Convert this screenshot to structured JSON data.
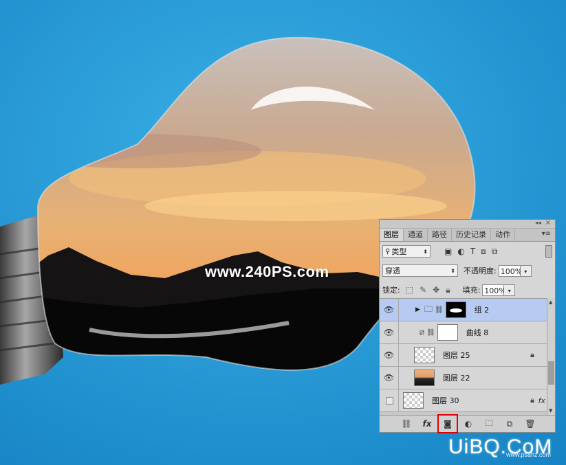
{
  "watermark": {
    "site": "www.240PS.com",
    "logo": "UiBQ.CoM",
    "sub": "www.psahz.com"
  },
  "panel": {
    "tabs": [
      {
        "label": "图层",
        "active": true
      },
      {
        "label": "通道",
        "active": false
      },
      {
        "label": "路径",
        "active": false
      },
      {
        "label": "历史记录",
        "active": false
      },
      {
        "label": "动作",
        "active": false
      }
    ],
    "filter": {
      "label": "类型"
    },
    "blend_mode": "穿透",
    "opacity_label": "不透明度:",
    "opacity_value": "100%",
    "lock_label": "锁定:",
    "fill_label": "填充:",
    "fill_value": "100%",
    "layers": [
      {
        "name": "组 2",
        "visible": true,
        "type": "group",
        "selected": true
      },
      {
        "name": "曲线 8",
        "visible": true,
        "type": "adjustment"
      },
      {
        "name": "图层 25",
        "visible": true,
        "type": "pixel",
        "locked": true
      },
      {
        "name": "图层 22",
        "visible": true,
        "type": "smart-object"
      },
      {
        "name": "图层 30",
        "visible": false,
        "type": "pixel",
        "locked": true,
        "fx": "fx"
      }
    ],
    "bottom_icons": [
      "link-icon",
      "fx-icon",
      "mask-icon",
      "adjustment-icon",
      "folder-icon",
      "new-layer-icon",
      "trash-icon"
    ],
    "highlight_color": "#e00000",
    "selected_color": "#b7cbf2"
  },
  "colors": {
    "background": "#1e9ad8"
  }
}
